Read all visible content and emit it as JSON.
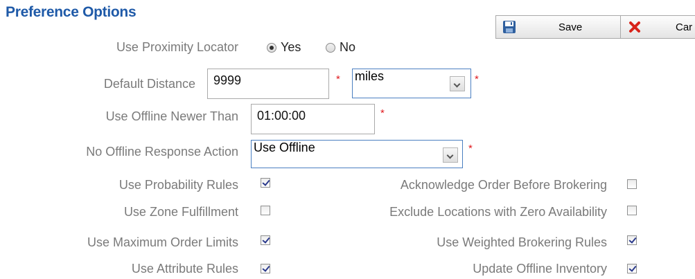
{
  "title": "Preference Options",
  "toolbar": {
    "save_label": "Save",
    "cancel_label": "Car"
  },
  "proximity": {
    "label": "Use Proximity Locator",
    "yes_label": "Yes",
    "no_label": "No",
    "selected": "Yes"
  },
  "default_distance": {
    "label": "Default Distance",
    "value": "9999",
    "unit": "miles",
    "required_mark": "*"
  },
  "offline_newer": {
    "label": "Use Offline Newer Than",
    "value": "01:00:00",
    "required_mark": "*"
  },
  "no_offline_action": {
    "label": "No Offline Response Action",
    "value": "Use Offline",
    "required_mark": "*"
  },
  "checks_left": [
    {
      "label": "Use Probability Rules",
      "checked": true
    },
    {
      "label": "Use Zone Fulfillment",
      "checked": false
    },
    {
      "label": "Use Maximum Order Limits",
      "checked": true
    },
    {
      "label": "Use Attribute Rules",
      "checked": true
    }
  ],
  "checks_right": [
    {
      "label": "Acknowledge Order Before Brokering",
      "checked": false
    },
    {
      "label": "Exclude Locations with Zero Availability",
      "checked": false
    },
    {
      "label": "Use Weighted Brokering Rules",
      "checked": true
    },
    {
      "label": "Update Offline Inventory",
      "checked": true
    }
  ],
  "colors": {
    "title": "#1f5aa8",
    "label": "#7a7a7a",
    "required": "#e0191e",
    "select_border": "#4a7fc1"
  },
  "icons": {
    "save": "floppy-disk-icon",
    "cancel": "red-x-icon"
  }
}
